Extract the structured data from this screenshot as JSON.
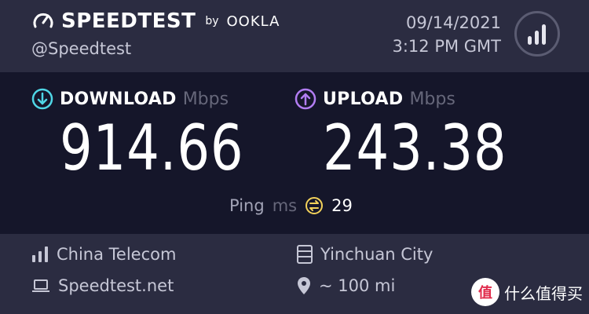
{
  "header": {
    "brand": "SPEEDTEST",
    "by": "by",
    "partner": "OOKLA",
    "handle": "@Speedtest",
    "date": "09/14/2021",
    "time": "3:12 PM GMT",
    "results_icon": "bar-chart-icon"
  },
  "download": {
    "label": "DOWNLOAD",
    "unit": "Mbps",
    "value": "914.66",
    "icon": "arrow-down-circle-icon",
    "color": "#4fd6e6"
  },
  "upload": {
    "label": "UPLOAD",
    "unit": "Mbps",
    "value": "243.38",
    "icon": "arrow-up-circle-icon",
    "color": "#b27df2"
  },
  "ping": {
    "label": "Ping",
    "unit": "ms",
    "value": "29",
    "icon": "ping-icon",
    "color": "#f2d15a"
  },
  "footer": {
    "isp": "China Telecom",
    "host": "Speedtest.net",
    "server": "Yinchuan City",
    "distance": "~ 100 mi"
  },
  "watermark": {
    "badge": "值",
    "text": "什么值得买"
  }
}
